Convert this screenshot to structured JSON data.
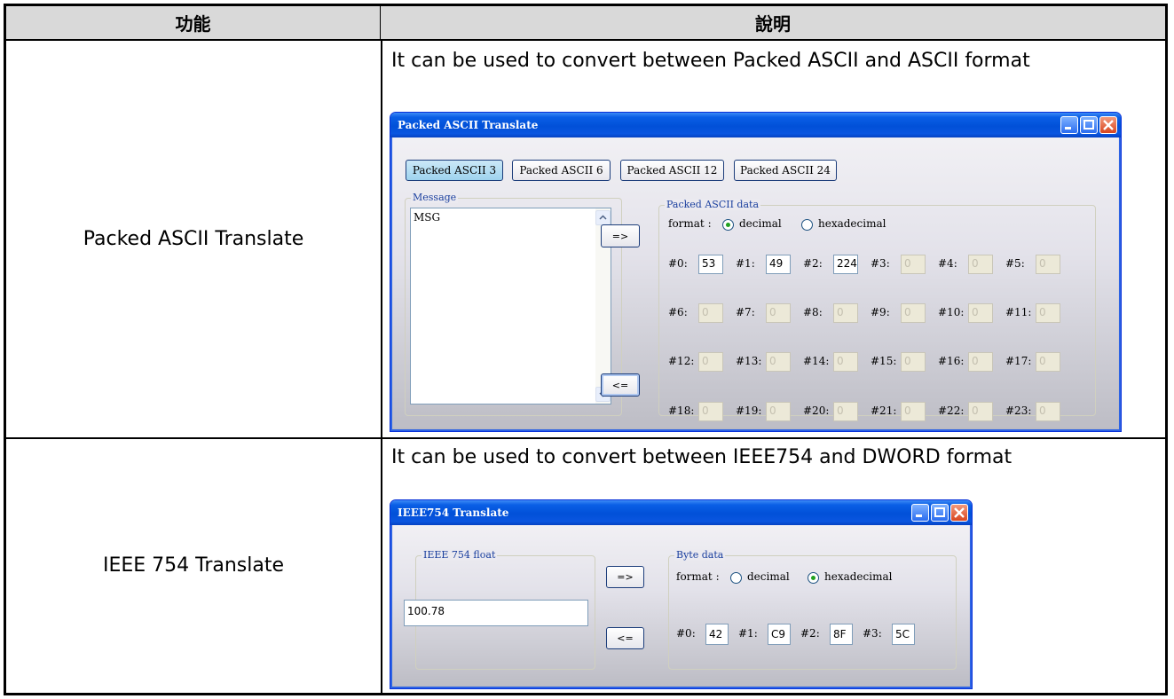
{
  "table": {
    "header_feature": "功能",
    "header_description": "說明"
  },
  "rows": [
    {
      "name": "Packed ASCII Translate",
      "description": "It can be used to convert between Packed ASCII and ASCII format"
    },
    {
      "name": "IEEE 754 Translate",
      "description": "It can be used to convert between IEEE754 and DWORD format"
    }
  ],
  "packed_window": {
    "title": "Packed ASCII Translate",
    "mode_buttons": [
      "Packed ASCII 3",
      "Packed ASCII 6",
      "Packed ASCII 12",
      "Packed ASCII 24"
    ],
    "active_mode": "Packed ASCII 3",
    "message_group_label": "Message",
    "message_text": "MSG",
    "to_right_label": "=>",
    "to_left_label": "<=",
    "data_group_label": "Packed ASCII data",
    "format_label": "format :",
    "format_options": [
      "decimal",
      "hexadecimal"
    ],
    "format_selected": "decimal",
    "fields": [
      {
        "label": "#0:",
        "value": "53"
      },
      {
        "label": "#1:",
        "value": "49"
      },
      {
        "label": "#2:",
        "value": "224"
      },
      {
        "label": "#3:",
        "value": "0"
      },
      {
        "label": "#4:",
        "value": "0"
      },
      {
        "label": "#5:",
        "value": "0"
      },
      {
        "label": "#6:",
        "value": "0"
      },
      {
        "label": "#7:",
        "value": "0"
      },
      {
        "label": "#8:",
        "value": "0"
      },
      {
        "label": "#9:",
        "value": "0"
      },
      {
        "label": "#10:",
        "value": "0"
      },
      {
        "label": "#11:",
        "value": "0"
      },
      {
        "label": "#12:",
        "value": "0"
      },
      {
        "label": "#13:",
        "value": "0"
      },
      {
        "label": "#14:",
        "value": "0"
      },
      {
        "label": "#15:",
        "value": "0"
      },
      {
        "label": "#16:",
        "value": "0"
      },
      {
        "label": "#17:",
        "value": "0"
      },
      {
        "label": "#18:",
        "value": "0"
      },
      {
        "label": "#19:",
        "value": "0"
      },
      {
        "label": "#20:",
        "value": "0"
      },
      {
        "label": "#21:",
        "value": "0"
      },
      {
        "label": "#22:",
        "value": "0"
      },
      {
        "label": "#23:",
        "value": "0"
      }
    ],
    "enabled_field_count": 3
  },
  "ieee_window": {
    "title": "IEEE754 Translate",
    "float_group_label": "IEEE 754 float",
    "float_value": "100.78",
    "to_right_label": "=>",
    "to_left_label": "<=",
    "byte_group_label": "Byte data",
    "format_label": "format :",
    "format_options": [
      "decimal",
      "hexadecimal"
    ],
    "format_selected": "hexadecimal",
    "fields": [
      {
        "label": "#0:",
        "value": "42"
      },
      {
        "label": "#1:",
        "value": "C9"
      },
      {
        "label": "#2:",
        "value": "8F"
      },
      {
        "label": "#3:",
        "value": "5C"
      }
    ]
  },
  "colors": {
    "titlebar": "#0150d8",
    "group_label": "#1a3f9e",
    "header_bg": "#d9d9d9",
    "radio_dot": "#21a121",
    "close_button": "#d8461f"
  }
}
